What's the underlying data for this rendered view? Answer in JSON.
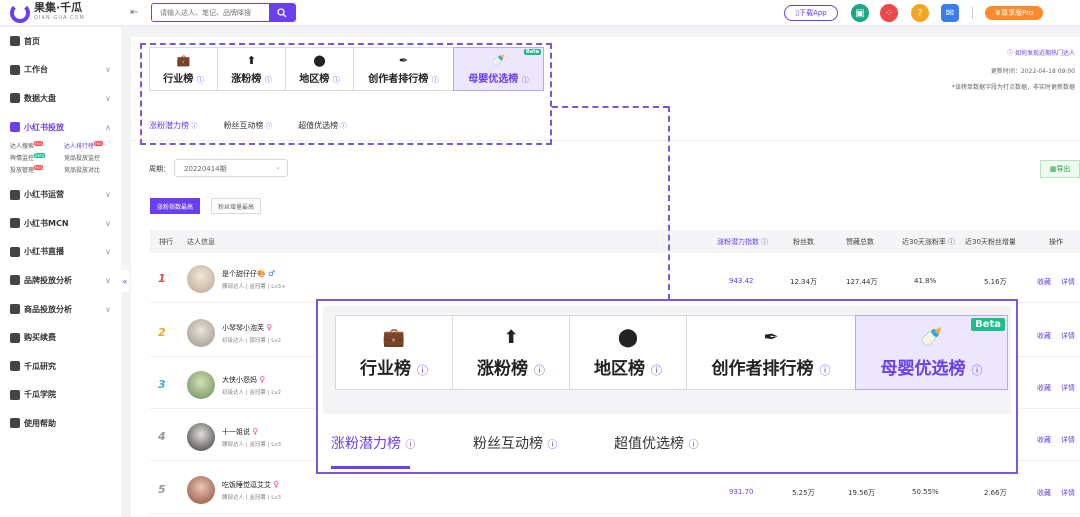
{
  "header": {
    "logo_title": "果集·千瓜",
    "logo_sub": "QIAN-GUA.COM",
    "search_placeholder": "请输入达人、笔记、品牌降搜",
    "download_label": "下载App",
    "pro_label": "尊享版Pro",
    "icons": [
      "gift-icon",
      "apps-icon",
      "question-icon",
      "mail-icon"
    ]
  },
  "sidebar": {
    "items": [
      {
        "label": "首页",
        "chevron": ""
      },
      {
        "label": "工作台",
        "chevron": "∨"
      },
      {
        "label": "数据大盘",
        "chevron": "∨"
      },
      {
        "label": "小红书投放",
        "chevron": "∧"
      },
      {
        "label": "小红书运营",
        "chevron": "∨"
      },
      {
        "label": "小红书MCN",
        "chevron": "∨"
      },
      {
        "label": "小红书直播",
        "chevron": "∨"
      },
      {
        "label": "品牌投放分析",
        "chevron": "∨"
      },
      {
        "label": "商品投放分析",
        "chevron": "∨"
      },
      {
        "label": "购买续费",
        "chevron": ""
      },
      {
        "label": "千瓜研究",
        "chevron": ""
      },
      {
        "label": "千瓜学院",
        "chevron": ""
      },
      {
        "label": "使用帮助",
        "chevron": ""
      }
    ],
    "sub": [
      "达人搜索",
      "达人排行榜",
      "舆情监控",
      "竞品投放监控",
      "投放管理",
      "竞品投放对比"
    ],
    "tag_hot": "Hot",
    "tag_beta": "Beta"
  },
  "ranking": {
    "tabs": [
      "行业榜",
      "涨粉榜",
      "地区榜",
      "创作者排行榜",
      "母婴优选榜"
    ],
    "beta": "Beta",
    "help_link": "如何发现近期热门达人",
    "update": "更新时间：2022-04-18 09:00",
    "note": "*该榜单数据字段为打点数据，非实时更新数据"
  },
  "subtabs": [
    "涨粉潜力榜",
    "粉丝互动榜",
    "超值优选榜"
  ],
  "filter": {
    "period_label": "周期：",
    "period_value": "20220414期",
    "export": "导出",
    "sort": [
      "涨粉指数最高",
      "粉丝增量最高"
    ]
  },
  "table": {
    "headers": [
      "排行",
      "达人信息",
      "涨粉潜力指数",
      "粉丝数",
      "赞藏总数",
      "近30天涨粉率",
      "近30天粉丝增量",
      "操作"
    ],
    "rows": [
      {
        "rank": "1",
        "name": "是个甜仔仔🎨",
        "gender": "♂",
        "meta": "腰部达人 | 金冠薯 | Lv3+",
        "index": "943.42",
        "fans": "12.34万",
        "likes": "127.44万",
        "rate": "41.8%",
        "gain": "5.16万",
        "act1": "收藏",
        "act2": "详情"
      },
      {
        "rank": "2",
        "name": "小琴琴小泡芙",
        "gender": "♀",
        "meta": "初级达人 | 银冠薯 | Lv2",
        "index": "",
        "fans": "",
        "likes": "",
        "rate": "",
        "gain": "",
        "act1": "收藏",
        "act2": "详情"
      },
      {
        "rank": "3",
        "name": "大侠小怨妈",
        "gender": "♀",
        "meta": "初级达人 | 金冠薯 | Lv2",
        "index": "",
        "fans": "",
        "likes": "",
        "rate": "",
        "gain": "",
        "act1": "收藏",
        "act2": "详情"
      },
      {
        "rank": "4",
        "name": "十一姐说",
        "gender": "♀",
        "meta": "腰部达人 | 金冠薯 | Lv3",
        "index": "",
        "fans": "",
        "likes": "",
        "rate": "",
        "gain": "",
        "act1": "收藏",
        "act2": "详情"
      },
      {
        "rank": "5",
        "name": "吃饭睡觉逗艾艾",
        "gender": "♀",
        "meta": "腰部达人 | 金冠薯 | Lv3",
        "index": "931.70",
        "fans": "5.25万",
        "likes": "19.56万",
        "rate": "50.55%",
        "gain": "2.66万",
        "act1": "收藏",
        "act2": "详情"
      }
    ]
  },
  "colors": {
    "accent": "#6a3ff0"
  }
}
